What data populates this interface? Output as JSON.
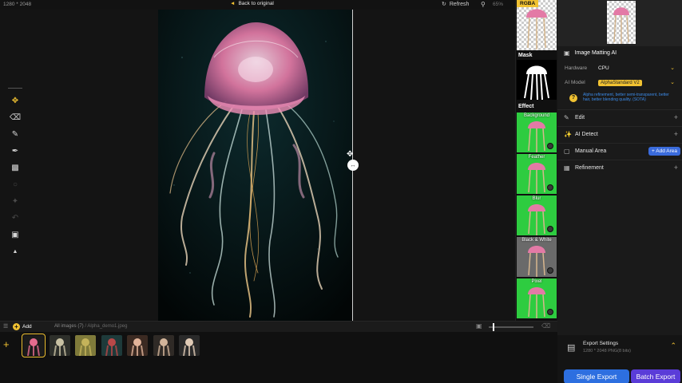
{
  "topbar": {
    "image_dims": "1280 * 2048",
    "back_label": "Back to original",
    "refresh_label": "Refresh",
    "zoom": "65%"
  },
  "toolbar": {
    "tools": [
      "move-icon",
      "eraser-icon",
      "brush-icon",
      "smart-brush-icon",
      "bucket-icon",
      "lasso-icon",
      "magic-icon",
      "undo-icon",
      "fit-screen-icon",
      "collapse-icon"
    ]
  },
  "effects": {
    "rgba_label": "RGBA",
    "mask_label": "Mask",
    "effect_label": "Effect",
    "items": [
      {
        "label": "Background",
        "color": "#2ecc40"
      },
      {
        "label": "Feather",
        "color": "#2ecc40"
      },
      {
        "label": "Blur",
        "color": "#2ecc40"
      },
      {
        "label": "Black & White",
        "color": "#6a6a6a"
      },
      {
        "label": "Pixel",
        "color": "#2ecc40"
      }
    ]
  },
  "panel": {
    "matting_title": "Image Matting AI",
    "hardware_label": "Hardware",
    "hardware_value": "CPU",
    "model_label": "AI Model",
    "model_value": "AlphaStandard  V2",
    "hint": "Alpha refinement, better semi-transparent, better hair, better blending quality. (SOTA)",
    "sections": [
      {
        "icon": "edit-icon",
        "label": "Edit"
      },
      {
        "icon": "ai-detect-icon",
        "label": "AI Detect"
      },
      {
        "icon": "manual-area-icon",
        "label": "Manual Area",
        "action": "Add Area"
      },
      {
        "icon": "refinement-icon",
        "label": "Refinement"
      }
    ]
  },
  "export": {
    "title": "Export Settings",
    "subtitle": "1280 * 2048 PNG(8 bits)",
    "single_label": "Single Export",
    "batch_label": "Batch Export"
  },
  "filmbar": {
    "add_label": "Add",
    "path_prefix": "All images (7)",
    "path_file": "/ Alpha_demo1.jpeg"
  },
  "filmstrip": {
    "thumbs": [
      {
        "bg": "#1b1b1b",
        "accent": "#e46b8e"
      },
      {
        "bg": "#2d2f2a",
        "accent": "#c8c1a3"
      },
      {
        "bg": "#7f7a3a",
        "accent": "#c4b35a"
      },
      {
        "bg": "#1e3a3a",
        "accent": "#b84848"
      },
      {
        "bg": "#3b2a22",
        "accent": "#e3b49a"
      },
      {
        "bg": "#2f2a26",
        "accent": "#d2b49a"
      },
      {
        "bg": "#2a2a2a",
        "accent": "#e0cbb6"
      }
    ],
    "selected_index": 0
  },
  "colors": {
    "accent": "#f1c232",
    "single_export": "#2d6fe0",
    "batch_export": "#5a3cd8",
    "add_area": "#3a6bdc",
    "hint": "#3c8be8"
  }
}
